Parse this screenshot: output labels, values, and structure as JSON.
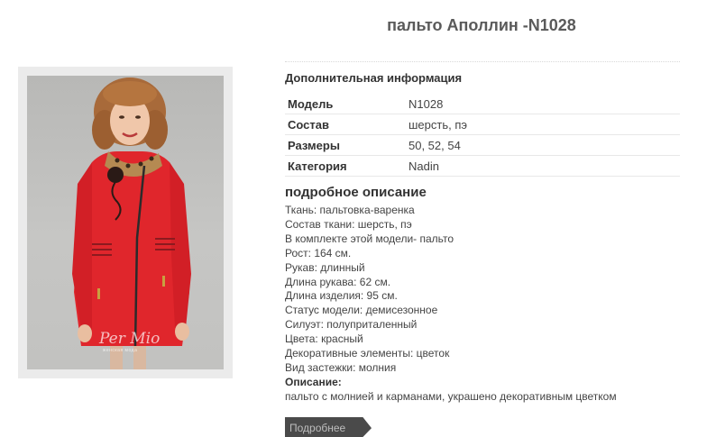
{
  "product": {
    "title": "пальто Аполлин -N1028",
    "watermark": "Per Mio",
    "watermark_sub": "женская мода"
  },
  "additional": {
    "heading": "Дополнительная информация",
    "rows": [
      {
        "key": "Модель",
        "value": "N1028"
      },
      {
        "key": "Состав",
        "value": "шерсть, пэ"
      },
      {
        "key": "Размеры",
        "value": "50, 52, 54"
      },
      {
        "key": "Категория",
        "value": "Nadin"
      }
    ]
  },
  "description": {
    "heading": "подробное описание",
    "lines": [
      "Ткань: пальтовка-варенка",
      "Состав ткани: шерсть, пэ",
      "В комплекте этой модели- пальто",
      "Рост: 164 см.",
      "Рукав: длинный",
      "Длина рукава: 62 см.",
      "Длина изделия: 95 см.",
      "Статус модели: демисезонное",
      "Силуэт: полуприталенный",
      "Цвета: красный",
      "Декоративные элементы: цветок",
      "Вид застежки: молния"
    ],
    "label": "Описание:",
    "text": "пальто с молнией и карманами, украшено декоративным цветком"
  },
  "buttons": {
    "more": "Подробнее"
  },
  "colors": {
    "coat": "#e0262c",
    "background": "#ffffff",
    "button": "#4a4a4a"
  }
}
